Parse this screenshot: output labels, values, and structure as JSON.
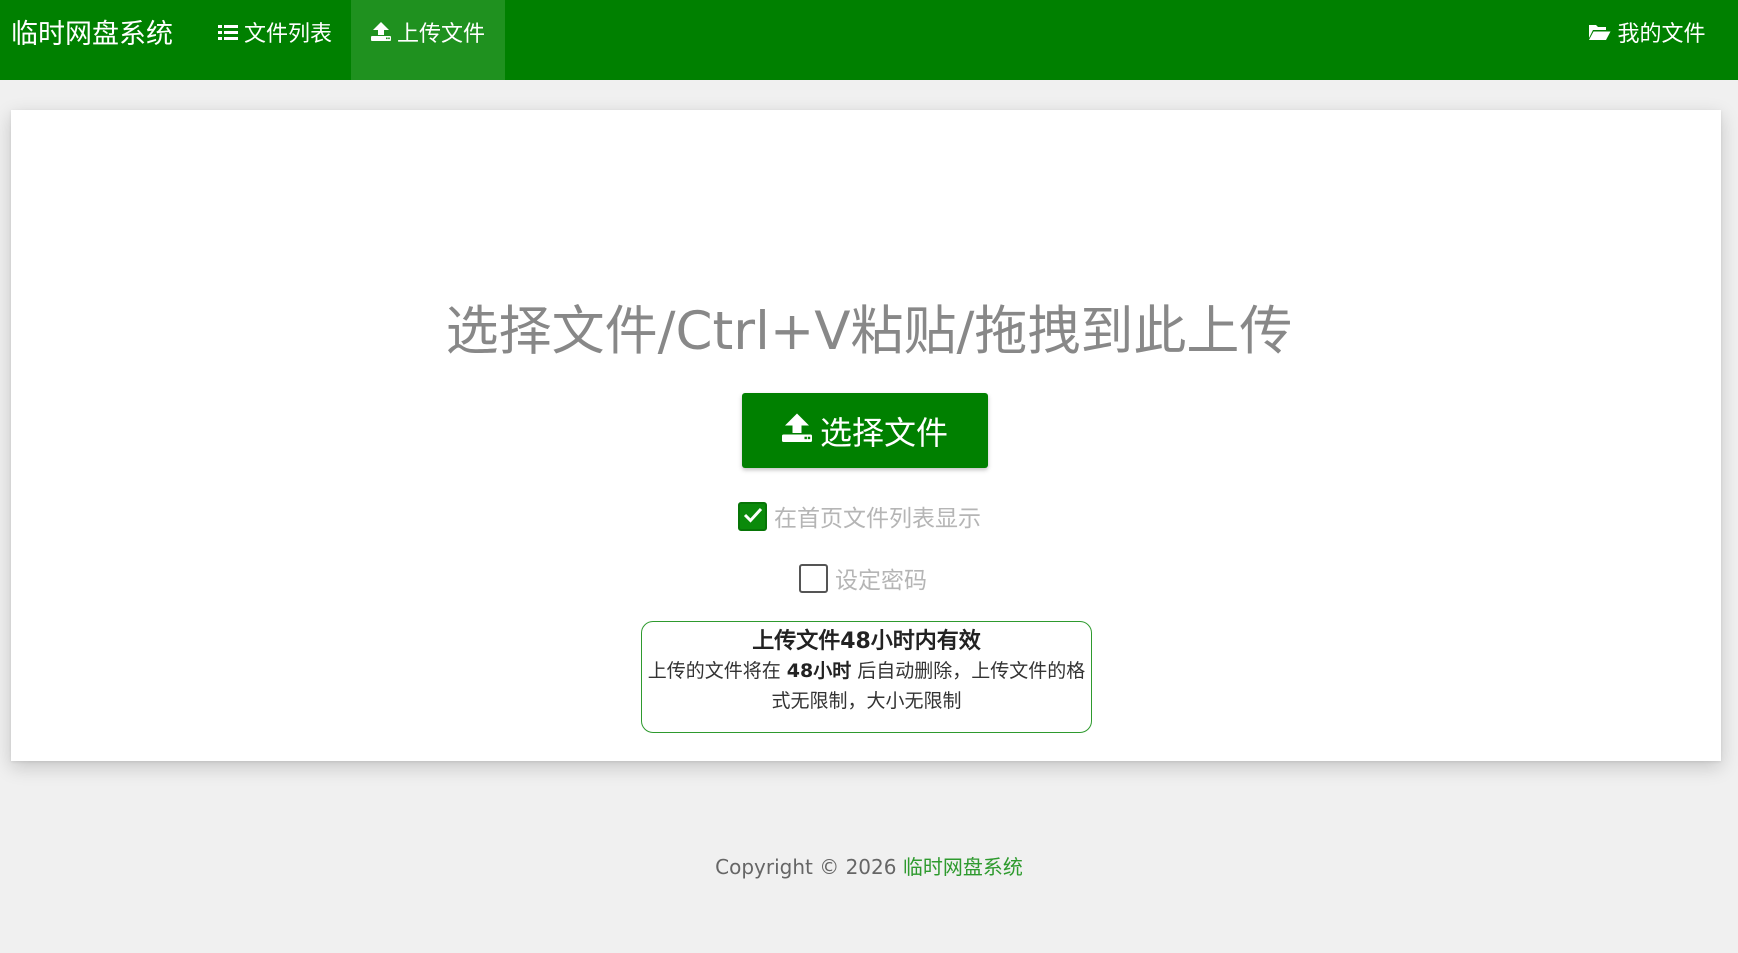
{
  "navbar": {
    "brand": "临时网盘系统",
    "items": [
      {
        "label": "文件列表",
        "icon": "list-icon"
      },
      {
        "label": "上传文件",
        "icon": "upload-icon",
        "active": true
      },
      {
        "label": "我的文件",
        "icon": "folder-open-icon"
      }
    ]
  },
  "upload": {
    "title": "选择文件/Ctrl+V粘贴/拖拽到此上传",
    "button_label": "选择文件",
    "button_icon": "upload-icon"
  },
  "options": {
    "show_on_home": {
      "label": "在首页文件列表显示",
      "checked": true
    },
    "set_password": {
      "label": "设定密码",
      "checked": false
    }
  },
  "notice": {
    "title": "上传文件48小时内有效",
    "body_prefix": "上传的文件将在",
    "body_highlight": "48小时",
    "body_suffix": "后自动删除，上传文件的格式无限制，大小无限制"
  },
  "footer": {
    "copyright": "Copyright © 2026",
    "site_name": "临时网盘系统"
  },
  "colors": {
    "brand_green": "#008000",
    "active_nav": "#1f911f",
    "page_background": "#f0f0f0"
  }
}
